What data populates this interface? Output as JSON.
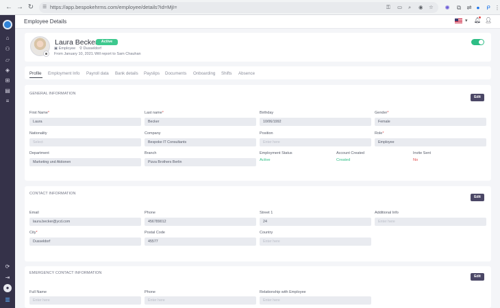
{
  "browser": {
    "url": "https://app.bespokehrms.com/employee/details?id=MjI=",
    "extension_icons": [
      "key-icon",
      "cast-icon",
      "zoom-icon",
      "eye-icon",
      "star-icon"
    ]
  },
  "header": {
    "title": "Employee Details"
  },
  "profile": {
    "name": "Laura Becker",
    "status": "Active",
    "role": "Employee",
    "location": "Dusseldorf",
    "since": "From January 10, 2021.",
    "reports_to": "Will report to Sam Chauhan",
    "enabled": true
  },
  "tabs": [
    "Profile",
    "Employment Info",
    "Payroll data",
    "Bank details",
    "Payslips",
    "Documents",
    "Onboarding",
    "Shifts",
    "Absence"
  ],
  "general": {
    "title": "GENERAL INFORMATION",
    "edit": "Edit",
    "first_name_label": "First Name",
    "first_name": "Laura",
    "last_name_label": "Last name",
    "last_name": "Becker",
    "birthday_label": "Birthday",
    "birthday": "10/06/1992",
    "gender_label": "Gender",
    "gender": "Female",
    "nationality_label": "Nationality",
    "nationality_placeholder": "Select",
    "company_label": "Company",
    "company": "Bespoke IT Consultants",
    "position_label": "Position",
    "position_placeholder": "Enter here",
    "role_label": "Role",
    "role": "Employee",
    "department_label": "Department",
    "department": "Marketing und Aktionen",
    "branch_label": "Branch",
    "branch": "Pizza Brothers Berlin",
    "employment_status_label": "Employment Status",
    "employment_status": "Active",
    "account_created_label": "Account Created",
    "account_created": "Created",
    "invite_sent_label": "Invite Sent",
    "invite_sent": "No"
  },
  "contact": {
    "title": "CONTACT INFORMATION",
    "edit": "Edit",
    "email_label": "Email",
    "email": "laura.becker@ycd.com",
    "phone_label": "Phone",
    "phone": "456789012",
    "street_label": "Street 1",
    "street": "24",
    "additional_label": "Additional Info",
    "additional_placeholder": "Enter here",
    "city_label": "City",
    "city": "Dusseldorf",
    "postal_label": "Postal Code",
    "postal": "45577",
    "country_label": "Country",
    "country_placeholder": "Enter here"
  },
  "emergency": {
    "title": "EMERGENCY CONTACT INFORMATION",
    "edit": "Edit",
    "full_name_label": "Full Name",
    "full_name_placeholder": "Enter here",
    "phone_label": "Phone",
    "phone_placeholder": "Enter here",
    "relationship_label": "Relationship with Employee",
    "relationship_placeholder": "Enter here"
  },
  "colors": {
    "accent": "#4b4766",
    "success": "#2ebd85",
    "danger": "#e24c4c",
    "sidebar": "#353249"
  }
}
